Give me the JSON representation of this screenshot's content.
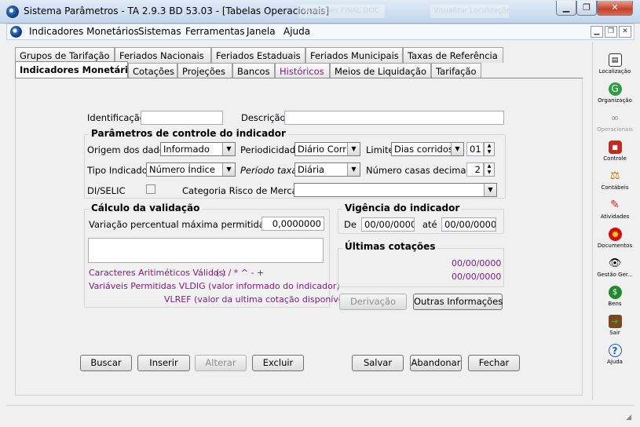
{
  "window": {
    "title": "Sistema Parâmetros - TA 2.9.3 BD 53.03 - [Tabelas Operacionais]",
    "ghost_tabs": [
      "Anotações FINAL.DOC",
      "Visualizar Localizações"
    ]
  },
  "menu": [
    "Indicadores Monetários",
    "Sistemas",
    "Ferramentas",
    "Janela",
    "Ajuda"
  ],
  "tabs_row1": [
    "Grupos de Tarifação",
    "Feriados Nacionais",
    "Feriados Estaduais",
    "Feriados Municipais",
    "Taxas de Referência"
  ],
  "tabs_row2": [
    "Indicadores Monetários",
    "Cotações",
    "Projeções",
    "Bancos",
    "Históricos",
    "Meios de Liquidação",
    "Tarifação"
  ],
  "form": {
    "identificacao_label": "Identificação",
    "identificacao_value": "",
    "descricao_label": "Descrição",
    "descricao_value": "",
    "params_title": "Parâmetros de controle do indicador",
    "origem_label": "Origem dos dados",
    "origem_value": "Informado",
    "periodicidade_label": "Periodicidade",
    "periodicidade_value": "Diário Corrido",
    "limite_label": "Limite",
    "limite_value": "Dias corridos",
    "limite_num": "01",
    "tipo_label": "Tipo Indicador",
    "tipo_value": "Número Índice",
    "periodo_label": "Período taxa",
    "periodo_value": "Diária",
    "casas_label": "Número casas decimais",
    "casas_value": "2",
    "diselic_label": "DI/SELIC",
    "diselic_checked": false,
    "categoria_label": "Categoria Risco de Mercado",
    "categoria_value": "",
    "calc_title": "Cálculo da validação",
    "variacao_label": "Variação percentual máxima permitida",
    "variacao_value": "0,0000000",
    "formula_value": "",
    "caracteres_label": "Caracteres Aritiméticos Válidos:",
    "caracteres_value": "( ) / * ^ - +",
    "variaveis_line": "Variáveis Permitidas VLDIG  (valor informado do indicador)",
    "vlref_line": "VLREF (valor da ultima cotação disponível)",
    "vigencia_title": "Vigência do indicador",
    "de_label": "De",
    "de_value": "00/00/0000",
    "ate_label": "até",
    "ate_value": "00/00/0000",
    "ultimas_title": "Últimas cotações",
    "ultimas_date1": "00/00/0000",
    "ultimas_date2": "00/00/0000",
    "derivacao": "Derivação",
    "outras": "Outras Informações"
  },
  "buttons": {
    "buscar": "Buscar",
    "inserir": "Inserir",
    "alterar": "Alterar",
    "excluir": "Excluir",
    "salvar": "Salvar",
    "abandonar": "Abandonar",
    "fechar": "Fechar"
  },
  "toolbar": [
    {
      "label": "Localização",
      "icon": "keyboard-icon",
      "enabled": true
    },
    {
      "label": "Organização",
      "icon": "globe-icon",
      "enabled": true
    },
    {
      "label": "Operacionais",
      "icon": "handshake-icon",
      "enabled": false
    },
    {
      "label": "Controle",
      "icon": "stop-sign-icon",
      "enabled": true
    },
    {
      "label": "Contábeis",
      "icon": "scales-icon",
      "enabled": true
    },
    {
      "label": "Atividades",
      "icon": "pen-icon",
      "enabled": true
    },
    {
      "label": "Documentos",
      "icon": "target-icon",
      "enabled": true
    },
    {
      "label": "Gestão Ger...",
      "icon": "eye-icon",
      "enabled": true
    },
    {
      "label": "Bens",
      "icon": "money-bag-icon",
      "enabled": true
    },
    {
      "label": "Sair",
      "icon": "exit-door-icon",
      "enabled": true
    },
    {
      "label": "Ajuda",
      "icon": "help-icon",
      "enabled": true
    }
  ]
}
